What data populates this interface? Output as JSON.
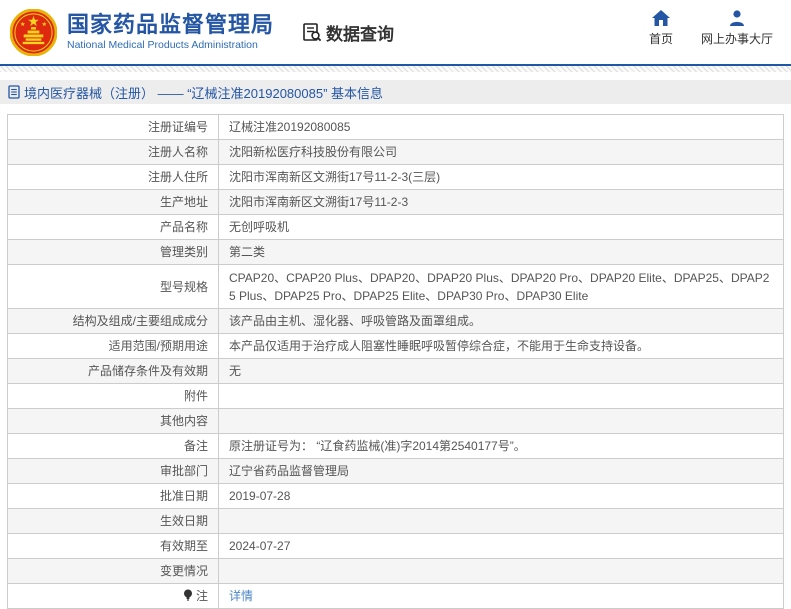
{
  "colors": {
    "accent_blue": "#2456a4",
    "line_blue": "#1d57a5",
    "link_blue": "#4a86c8",
    "row_alt_gray": "#f5f5f6",
    "emblem_red": "#de2910",
    "emblem_gold": "#f7d21e"
  },
  "header": {
    "title": "国家药品监督管理局",
    "subtitle": "National Medical Products Administration",
    "query_label": "数据查询",
    "nav": {
      "home": "首页",
      "hall": "网上办事大厅"
    }
  },
  "breadcrumb": "境内医疗器械（注册） —— “辽械注准20192080085” 基本信息",
  "table": {
    "rows": [
      {
        "label": "注册证编号",
        "value": "辽械注准20192080085"
      },
      {
        "label": "注册人名称",
        "value": "沈阳新松医疗科技股份有限公司"
      },
      {
        "label": "注册人住所",
        "value": "沈阳市浑南新区文溯街17号11-2-3(三层)"
      },
      {
        "label": "生产地址",
        "value": "沈阳市浑南新区文溯街17号11-2-3"
      },
      {
        "label": "产品名称",
        "value": "无创呼吸机"
      },
      {
        "label": "管理类别",
        "value": "第二类"
      },
      {
        "label": "型号规格",
        "value": "CPAP20、CPAP20 Plus、DPAP20、DPAP20 Plus、DPAP20 Pro、DPAP20 Elite、DPAP25、DPAP25 Plus、DPAP25 Pro、DPAP25 Elite、DPAP30 Pro、DPAP30 Elite"
      },
      {
        "label": "结构及组成/主要组成成分",
        "value": "该产品由主机、湿化器、呼吸管路及面罩组成。"
      },
      {
        "label": "适用范围/预期用途",
        "value": "本产品仅适用于治疗成人阻塞性睡眠呼吸暂停综合症，不能用于生命支持设备。"
      },
      {
        "label": "产品储存条件及有效期",
        "value": "无"
      },
      {
        "label": "附件",
        "value": ""
      },
      {
        "label": "其他内容",
        "value": ""
      },
      {
        "label": "备注",
        "value": "原注册证号为： “辽食药监械(准)字2014第2540177号”。"
      },
      {
        "label": "审批部门",
        "value": "辽宁省药品监督管理局"
      },
      {
        "label": "批准日期",
        "value": "2019-07-28"
      },
      {
        "label": "生效日期",
        "value": ""
      },
      {
        "label": "有效期至",
        "value": "2024-07-27"
      },
      {
        "label": "变更情况",
        "value": ""
      },
      {
        "label": "注",
        "value": "详情"
      }
    ]
  }
}
